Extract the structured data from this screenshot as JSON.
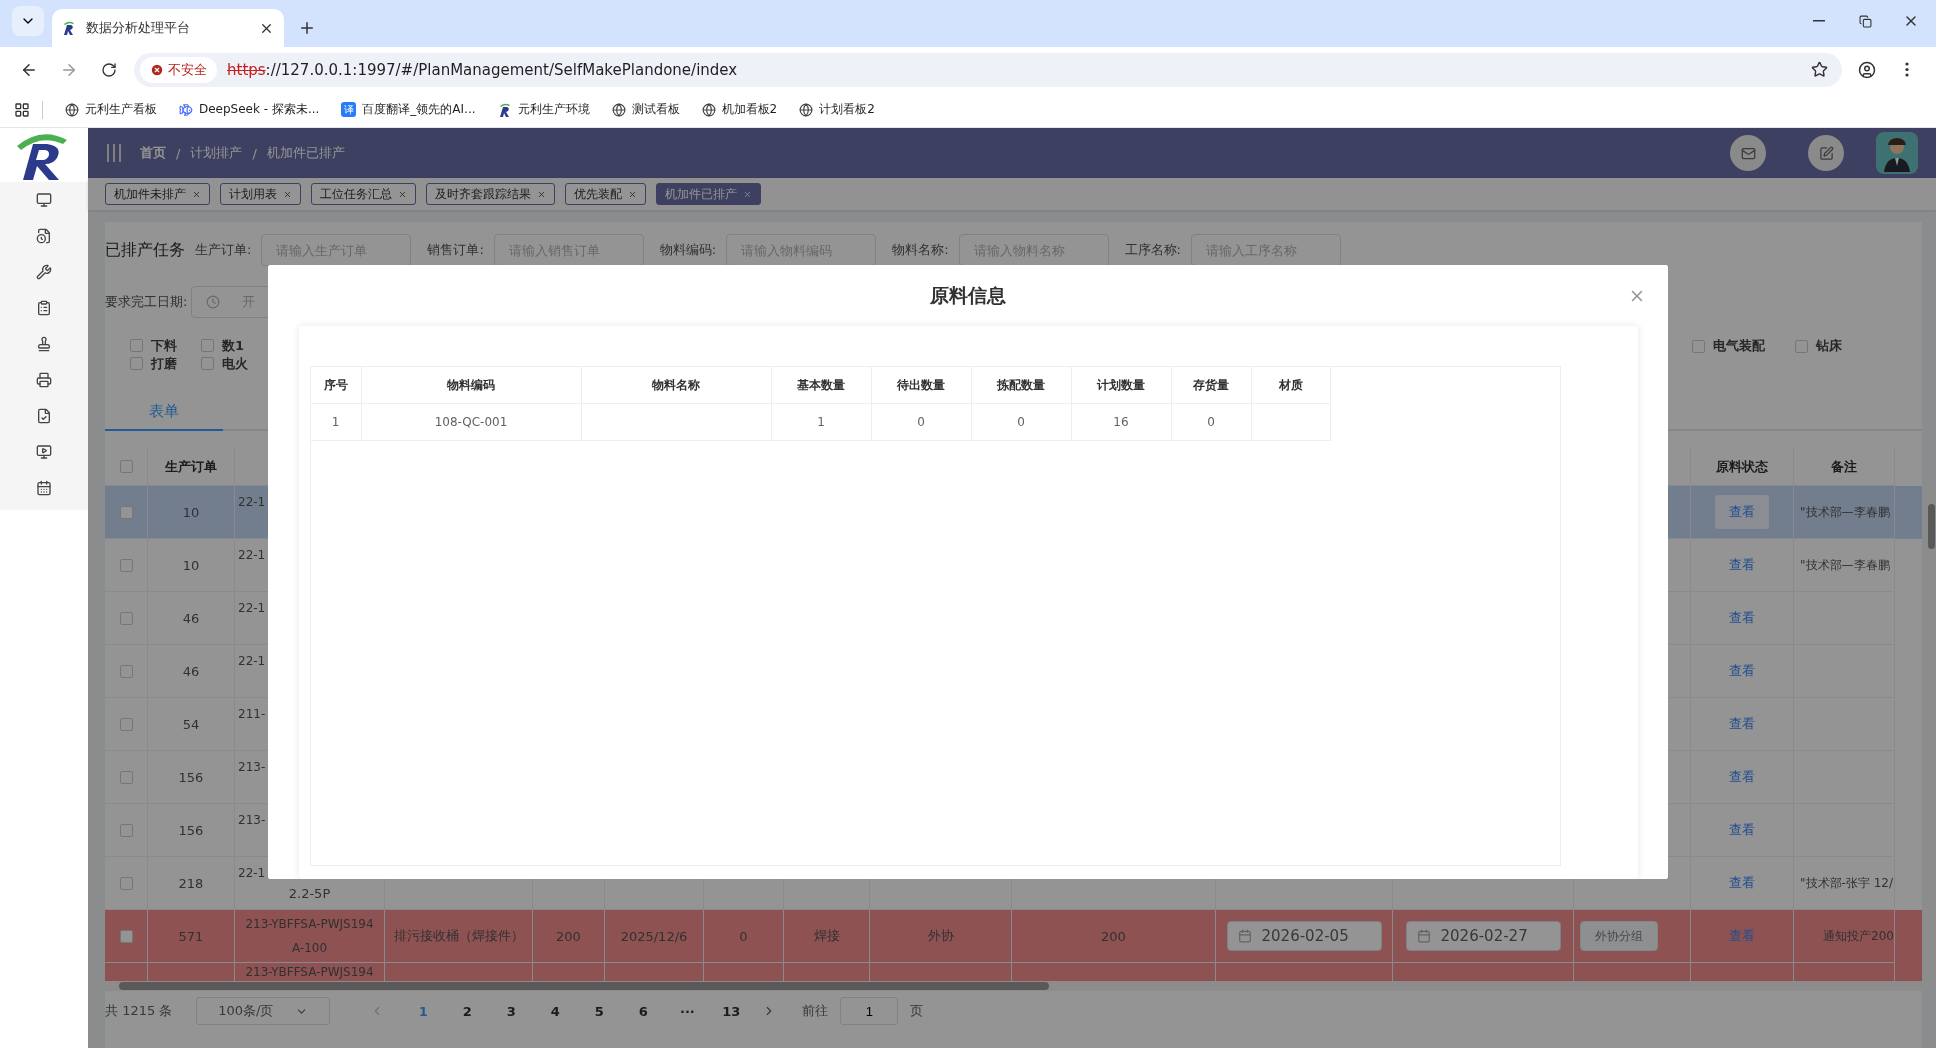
{
  "browser": {
    "tab_title": "数据分析处理平台",
    "security_badge": "不安全",
    "url_scheme": "https",
    "url_rest": "://127.0.0.1:1997/#/PlanManagement/SelfMakePlandone/index",
    "bookmarks": [
      {
        "kind": "globe",
        "label": "元利生产看板"
      },
      {
        "kind": "whale",
        "label": "DeepSeek - 探索未..."
      },
      {
        "kind": "badge",
        "badge": "译",
        "label": "百度翻译_领先的AI..."
      },
      {
        "kind": "logo",
        "label": "元利生产环境"
      },
      {
        "kind": "globe",
        "label": "测试看板"
      },
      {
        "kind": "globe",
        "label": "机加看板2"
      },
      {
        "kind": "globe",
        "label": "计划看板2"
      }
    ]
  },
  "header": {
    "breadcrumb": [
      "首页",
      "计划排产",
      "机加件已排产"
    ],
    "separator": "/"
  },
  "tags": [
    {
      "label": "机加件未排产",
      "selected": false
    },
    {
      "label": "计划用表",
      "selected": false
    },
    {
      "label": "工位任务汇总",
      "selected": false
    },
    {
      "label": "及时齐套跟踪结果",
      "selected": false
    },
    {
      "label": "优先装配",
      "selected": false
    },
    {
      "label": "机加件已排产",
      "selected": true
    }
  ],
  "filters": {
    "title": "已排产任务",
    "fields": [
      {
        "label": "生产订单:",
        "placeholder": "请输入生产订单"
      },
      {
        "label": "销售订单:",
        "placeholder": "请输入销售订单"
      },
      {
        "label": "物料编码:",
        "placeholder": "请输入物料编码"
      },
      {
        "label": "物料名称:",
        "placeholder": "请输入物料名称"
      },
      {
        "label": "工序名称:",
        "placeholder": "请输入工序名称"
      }
    ],
    "due_label": "要求完工日期:",
    "due_placeholder": "开",
    "process_checks": [
      {
        "label": "下料",
        "checked": false
      },
      {
        "label": "打磨",
        "checked": false
      },
      {
        "label": "数1",
        "checked": false
      },
      {
        "label": "电火",
        "checked": false
      }
    ],
    "process_checks_right": [
      {
        "label": "电气装配",
        "checked": false
      },
      {
        "label": "钻床",
        "checked": false
      }
    ]
  },
  "view_tabs": [
    {
      "label": "表单",
      "selected": true
    }
  ],
  "table": {
    "all_checked": false,
    "headers": {
      "order": "生产订单",
      "material_status": "原料状态",
      "remark": "备注"
    },
    "rows": [
      {
        "selected": true,
        "warning": false,
        "checked": false,
        "order": "10",
        "code": "22-1",
        "status": "查看",
        "remark": "\"技术部—李春鹏"
      },
      {
        "selected": false,
        "warning": false,
        "checked": false,
        "order": "10",
        "code": "22-1",
        "status": "查看",
        "remark": "\"技术部—李春鹏"
      },
      {
        "selected": false,
        "warning": false,
        "checked": false,
        "order": "46",
        "code": "22-1",
        "status": "查看"
      },
      {
        "selected": false,
        "warning": false,
        "checked": false,
        "order": "46",
        "code": "22-1",
        "status": "查看"
      },
      {
        "selected": false,
        "warning": false,
        "checked": false,
        "order": "54",
        "code": "211-",
        "status": "查看"
      },
      {
        "selected": false,
        "warning": false,
        "checked": false,
        "order": "156",
        "code": "213-",
        "status": "查看"
      },
      {
        "selected": false,
        "warning": false,
        "checked": false,
        "order": "156",
        "code": "213-",
        "status": "查看"
      },
      {
        "selected": false,
        "warning": false,
        "checked": false,
        "order": "218",
        "code": "22-1",
        "code_2": "2.2-5P",
        "status": "查看",
        "remark": "\"技术部-张宇 12/"
      },
      {
        "selected": false,
        "warning": true,
        "checked": false,
        "order": "571",
        "code": "213-YBFFSA-PWJS194",
        "code_2": "A-100",
        "name": "排污接收桶（焊接件）",
        "qty": "200",
        "due": "2025/12/6",
        "col_7": "0",
        "process": "焊接",
        "col_9": "外协",
        "col_10": "200",
        "date_1": "2026-02-05",
        "date_2": "2026-02-27",
        "action": "外协分组",
        "status": "查看",
        "remark": "通知投产200"
      },
      {
        "warning": true,
        "code": "213-YBFFSA-PWJS194"
      }
    ]
  },
  "pagination": {
    "total": "共 1215 条",
    "page_size": "100条/页",
    "pages": [
      {
        "label": "1",
        "selected": true
      },
      {
        "label": "2",
        "selected": false
      },
      {
        "label": "3",
        "selected": false
      },
      {
        "label": "4",
        "selected": false
      },
      {
        "label": "5",
        "selected": false
      },
      {
        "label": "6",
        "selected": false
      },
      {
        "label": "···",
        "selected": false
      },
      {
        "label": "13",
        "selected": false
      }
    ],
    "goto_label": "前往",
    "goto_value": "1",
    "page_unit": "页"
  },
  "modal": {
    "title": "原料信息",
    "columns": [
      "序号",
      "物料编码",
      "物料名称",
      "基本数量",
      "待出数量",
      "拣配数量",
      "计划数量",
      "存货量",
      "材质"
    ],
    "rows": [
      [
        "1",
        "108-QC-001",
        "",
        "1",
        "0",
        "0",
        "16",
        "0",
        ""
      ]
    ]
  }
}
